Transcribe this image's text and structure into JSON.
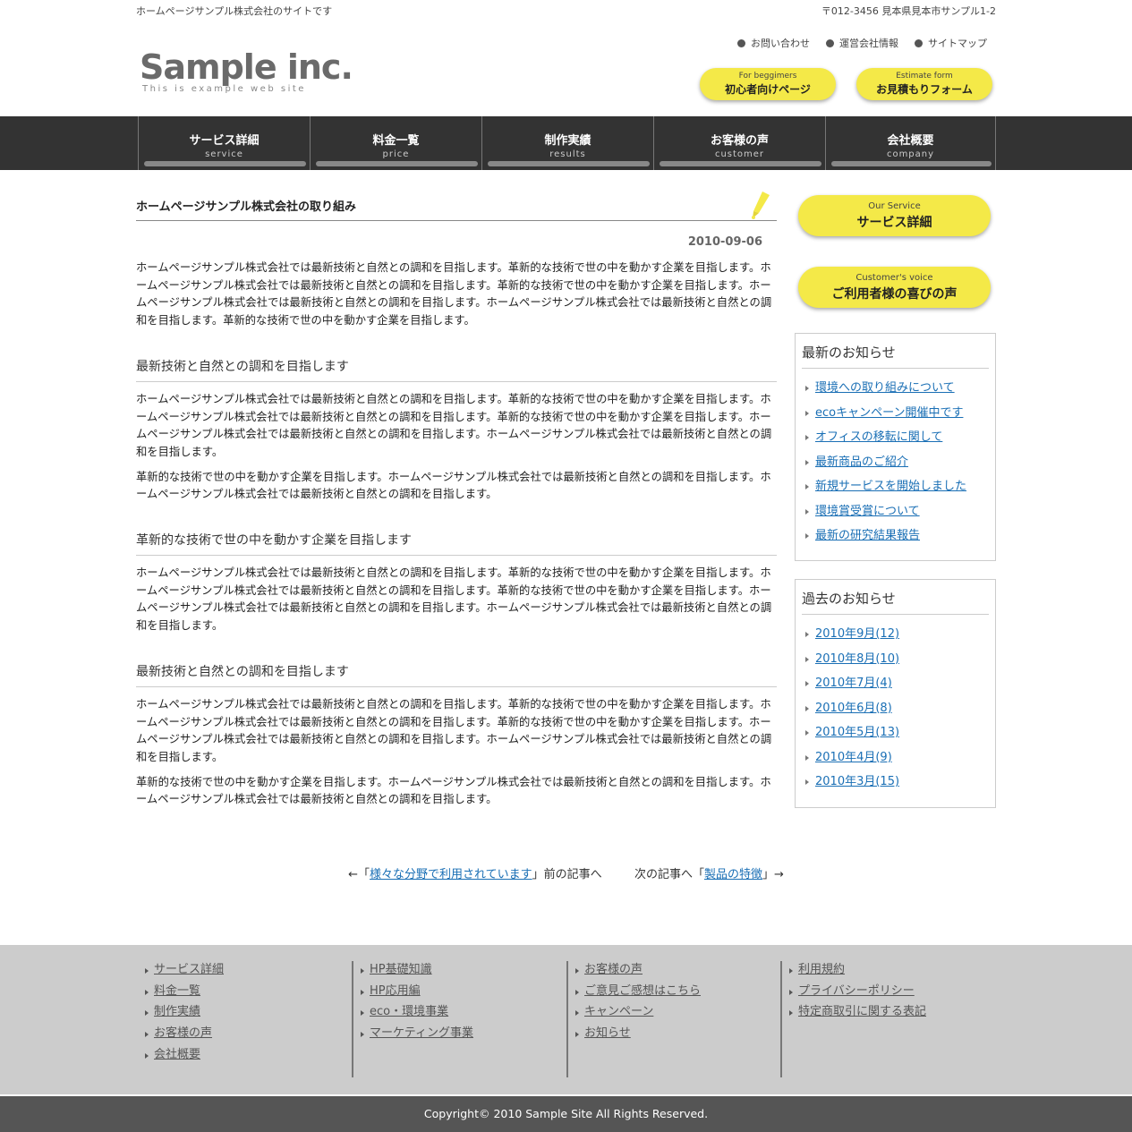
{
  "topbar": {
    "tagline": "ホームページサンプル株式会社のサイトです",
    "address": "〒012-3456 見本県見本市サンプル1-2"
  },
  "util_links": [
    "お問い合わせ",
    "運営会社情報",
    "サイトマップ"
  ],
  "logo": {
    "name": "Sample inc.",
    "sub": "This is example web site"
  },
  "header_buttons": [
    {
      "en": "For beggimers",
      "jp": "初心者向けページ"
    },
    {
      "en": "Estimate form",
      "jp": "お見積もりフォーム"
    }
  ],
  "nav": [
    {
      "jp": "サービス詳細",
      "en": "service"
    },
    {
      "jp": "料金一覧",
      "en": "price"
    },
    {
      "jp": "制作実績",
      "en": "results"
    },
    {
      "jp": "お客様の声",
      "en": "customer"
    },
    {
      "jp": "会社概要",
      "en": "company"
    }
  ],
  "article": {
    "title": "ホームページサンプル株式会社の取り組み",
    "date": "2010-09-06",
    "intro": "ホームページサンプル株式会社では最新技術と自然との調和を目指します。革新的な技術で世の中を動かす企業を目指します。ホームページサンプル株式会社では最新技術と自然との調和を目指します。革新的な技術で世の中を動かす企業を目指します。ホームページサンプル株式会社では最新技術と自然との調和を目指します。ホームページサンプル株式会社では最新技術と自然との調和を目指します。革新的な技術で世の中を動かす企業を目指します。",
    "sections": [
      {
        "heading": "最新技術と自然との調和を目指します",
        "p1": "ホームページサンプル株式会社では最新技術と自然との調和を目指します。革新的な技術で世の中を動かす企業を目指します。ホームページサンプル株式会社では最新技術と自然との調和を目指します。革新的な技術で世の中を動かす企業を目指します。ホームページサンプル株式会社では最新技術と自然との調和を目指します。ホームページサンプル株式会社では最新技術と自然との調和を目指します。",
        "p2": "革新的な技術で世の中を動かす企業を目指します。ホームページサンプル株式会社では最新技術と自然との調和を目指します。ホームページサンプル株式会社では最新技術と自然との調和を目指します。"
      },
      {
        "heading": "革新的な技術で世の中を動かす企業を目指します",
        "p1": "ホームページサンプル株式会社では最新技術と自然との調和を目指します。革新的な技術で世の中を動かす企業を目指します。ホームページサンプル株式会社では最新技術と自然との調和を目指します。革新的な技術で世の中を動かす企業を目指します。ホームページサンプル株式会社では最新技術と自然との調和を目指します。ホームページサンプル株式会社では最新技術と自然との調和を目指します。"
      },
      {
        "heading": "最新技術と自然との調和を目指します",
        "p1": "ホームページサンプル株式会社では最新技術と自然との調和を目指します。革新的な技術で世の中を動かす企業を目指します。ホームページサンプル株式会社では最新技術と自然との調和を目指します。革新的な技術で世の中を動かす企業を目指します。ホームページサンプル株式会社では最新技術と自然との調和を目指します。ホームページサンプル株式会社では最新技術と自然との調和を目指します。",
        "p2": "革新的な技術で世の中を動かす企業を目指します。ホームページサンプル株式会社では最新技術と自然との調和を目指します。ホームページサンプル株式会社では最新技術と自然との調和を目指します。"
      }
    ]
  },
  "pager": {
    "prev_prefix": "←「",
    "prev_link": "様々な分野で利用されています",
    "prev_suffix": "」前の記事へ",
    "next_prefix": "次の記事へ「",
    "next_link": "製品の特徴",
    "next_suffix": "」→"
  },
  "side_buttons": [
    {
      "en": "Our Service",
      "jp": "サービス詳細"
    },
    {
      "en": "Customer's voice",
      "jp": "ご利用者様の喜びの声"
    }
  ],
  "latest_news": {
    "title": "最新のお知らせ",
    "items": [
      "環境への取り組みについて",
      "ecoキャンペーン開催中です",
      "オフィスの移転に関して",
      "最新商品のご紹介",
      "新規サービスを開始しました",
      "環境賞受賞について",
      "最新の研究結果報告"
    ]
  },
  "past_news": {
    "title": "過去のお知らせ",
    "items": [
      "2010年9月(12)",
      "2010年8月(10)",
      "2010年7月(4)",
      "2010年6月(8)",
      "2010年5月(13)",
      "2010年4月(9)",
      "2010年3月(15)"
    ]
  },
  "footer_cols": [
    [
      "サービス詳細",
      "料金一覧",
      "制作実績",
      "お客様の声",
      "会社概要"
    ],
    [
      "HP基礎知識",
      "HP応用編",
      "eco・環境事業",
      "マーケティング事業"
    ],
    [
      "お客様の声",
      "ご意見ご感想はこちら",
      "キャンペーン",
      "お知らせ"
    ],
    [
      "利用規約",
      "プライバシーポリシー",
      "特定商取引に関する表記"
    ]
  ],
  "copyright": "Copyright© 2010 Sample Site All Rights Reserved.",
  "colors": {
    "accent_yellow": "#f4e948",
    "nav_bg": "#333333",
    "footer_bg": "#cccccc",
    "link": "#1a6fb5"
  }
}
